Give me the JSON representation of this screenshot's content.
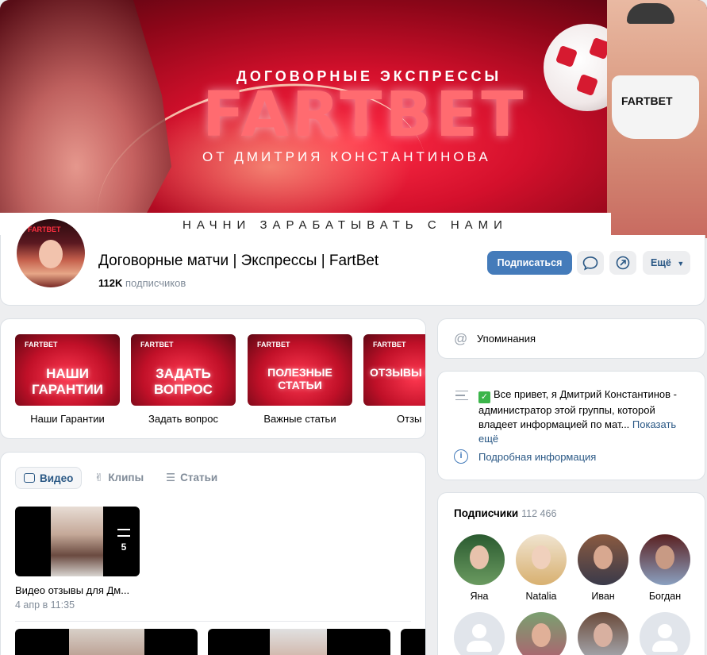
{
  "cover": {
    "subtitle": "ДОГОВОРНЫЕ ЭКСПРЕССЫ",
    "brand": "FARTBET",
    "author": "ОТ ДМИТРИЯ КОНСТАНТИНОВА",
    "tagline": "НАЧНИ ЗАРАБАТЫВАТЬ С НАМИ",
    "shirt_text": "FARTBET"
  },
  "group": {
    "avatar_tag": "FARTBET",
    "name": "Договорные матчи | Экспрессы | FartBet",
    "subscribers_count": "112K",
    "subscribers_label": "подписчиков",
    "subscribe_button": "Подписаться",
    "more_button": "Ещё",
    "accent_color": "#447bba"
  },
  "links": [
    {
      "brand": "FARTBET",
      "art": "НАШИ ГАРАНТИИ",
      "label": "Наши Гарантии"
    },
    {
      "brand": "FARTBET",
      "art": "ЗАДАТЬ ВОПРОС",
      "label": "Задать вопрос"
    },
    {
      "brand": "FARTBET",
      "art": "ПОЛЕЗНЫЕ СТАТЬИ",
      "label": "Важные статьи"
    },
    {
      "brand": "FARTBET",
      "art": "ОТЗЫВЫ КЛИЕН",
      "label": "Отзы"
    }
  ],
  "media": {
    "tabs": [
      {
        "label": "Видео",
        "icon": "video-icon"
      },
      {
        "label": "Клипы",
        "icon": "clips-icon"
      },
      {
        "label": "Статьи",
        "icon": "articles-icon"
      }
    ],
    "playlist": {
      "count": "5",
      "title": "Видео отзывы для Дм...",
      "date": "4 апр в 11:35"
    }
  },
  "mentions": {
    "label": "Упоминания",
    "icon": "at-icon"
  },
  "about": {
    "text": "Все привет, я Дмитрий Константинов - администратор этой группы, которой владеет информацией по мат...",
    "show_more": "Показать ещё",
    "info_link": "Подробная информация"
  },
  "subscribers": {
    "title": "Подписчики",
    "count": "112 466",
    "people": [
      {
        "name": "Яна"
      },
      {
        "name": "Natalia"
      },
      {
        "name": "Иван"
      },
      {
        "name": "Богдан"
      }
    ]
  }
}
